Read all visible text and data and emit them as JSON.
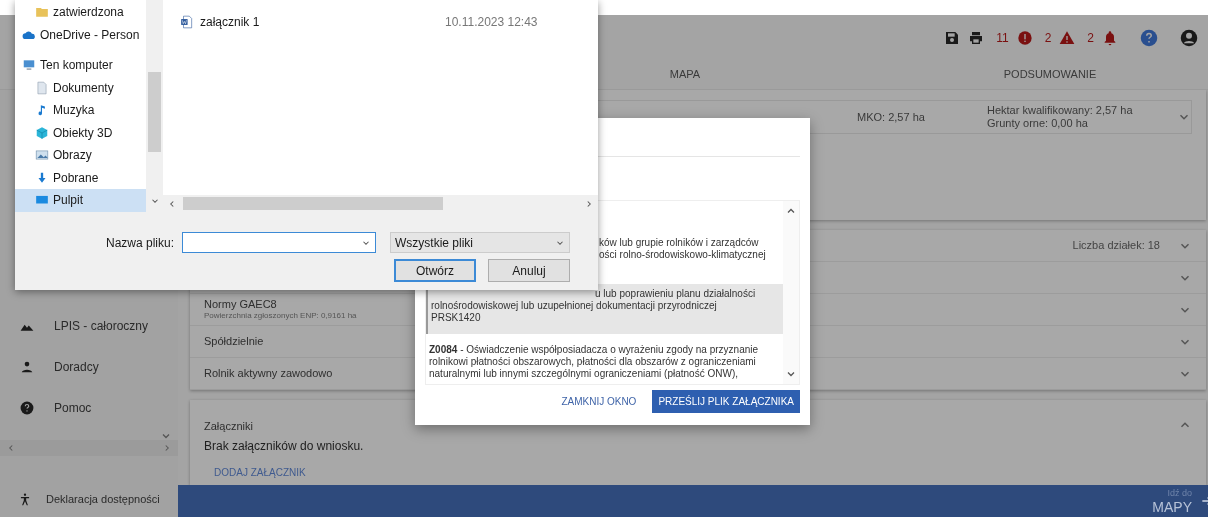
{
  "header": {
    "counts": [
      {
        "kind": "error",
        "value": "11"
      },
      {
        "kind": "warning",
        "value": "2"
      },
      {
        "kind": "notification",
        "value": "2"
      }
    ]
  },
  "tabs": [
    "MAPA",
    "PODSUMOWANIE"
  ],
  "summary_row": {
    "area": "MKO: 2,57 ha",
    "details": [
      "Hektar kwalifikowany: 2,57 ha",
      "Grunty orne: 0,00 ha"
    ],
    "expanded": false
  },
  "sections": [
    {
      "meta": "Liczba działek: 18",
      "expanded": false
    },
    {
      "expanded": false
    },
    {
      "title": "Normy GAEC8",
      "subtitle": "Powierzchnia zgłoszonych ENP: 0,9161 ha",
      "expanded": false
    },
    {
      "title": "Spółdzielnie",
      "expanded": false
    },
    {
      "title": "Rolnik aktywny zawodowo",
      "expanded": false
    }
  ],
  "attachments": {
    "title": "Załączniki",
    "empty_text": "Brak załączników do wniosku.",
    "add_link": "DODAJ ZAŁĄCZNIK",
    "expanded": true
  },
  "sidebar": {
    "items": [
      {
        "kind": "mountains",
        "label": "LPIS - całoroczny"
      },
      {
        "kind": "person",
        "label": "Doradcy"
      },
      {
        "kind": "help",
        "label": "Pomoc"
      }
    ],
    "footer": {
      "kind": "accessibility",
      "label": "Deklaracja dostępności"
    }
  },
  "footer_bar": {
    "caption": "Idź do",
    "target": "MAPY"
  },
  "modal": {
    "items": [
      {
        "selected": false,
        "lines": [
          "ków lub grupie rolników i zarządców",
          "ości rolno-środowiskowo-klimatycznej"
        ]
      },
      {
        "selected": true,
        "lines": [
          "u lub poprawieniu planu działalności",
          "rolnośrodowiskowej lub uzupełnionej dokumentacji przyrodniczej",
          "PRSK1420"
        ]
      },
      {
        "selected": false,
        "text": "**Z0084** - Oświadczenie współposiadacza o wyrażeniu zgody na przyznanie rolnikowi płatności obszarowych, płatności dla obszarów z ograniczeniami naturalnymi lub innymi szczególnymi ograniczeniami (płatność ONW),"
      }
    ],
    "buttons": [
      {
        "kind": "text",
        "label": "ZAMKNIJ OKNO"
      },
      {
        "kind": "primary",
        "label": "PRZEŚLIJ PLIK ZAŁĄCZNIKA"
      }
    ]
  },
  "file_dialog": {
    "nav": [
      {
        "kind": "folder",
        "label": "zatwierdzona",
        "selected": false
      },
      {
        "kind": "cloud",
        "label": "OneDrive - Person",
        "selected": false
      },
      {
        "kind": "computer",
        "label": "Ten komputer",
        "selected": false,
        "children": [
          {
            "kind": "documents",
            "label": "Dokumenty",
            "selected": false
          },
          {
            "kind": "music",
            "label": "Muzyka",
            "selected": false
          },
          {
            "kind": "objects3d",
            "label": "Obiekty 3D",
            "selected": false
          },
          {
            "kind": "pictures",
            "label": "Obrazy",
            "selected": false
          },
          {
            "kind": "downloads",
            "label": "Pobrane",
            "selected": false
          },
          {
            "kind": "desktop",
            "label": "Pulpit",
            "selected": true
          }
        ]
      }
    ],
    "files": [
      {
        "name": "załącznik 1",
        "modified": "10.11.2023 12:43"
      }
    ],
    "file_name_label": "Nazwa pliku:",
    "filter": "Wszystkie pliki",
    "buttons": [
      {
        "label": "Otwórz",
        "focused": true
      },
      {
        "label": "Anuluj",
        "focused": false
      }
    ]
  }
}
